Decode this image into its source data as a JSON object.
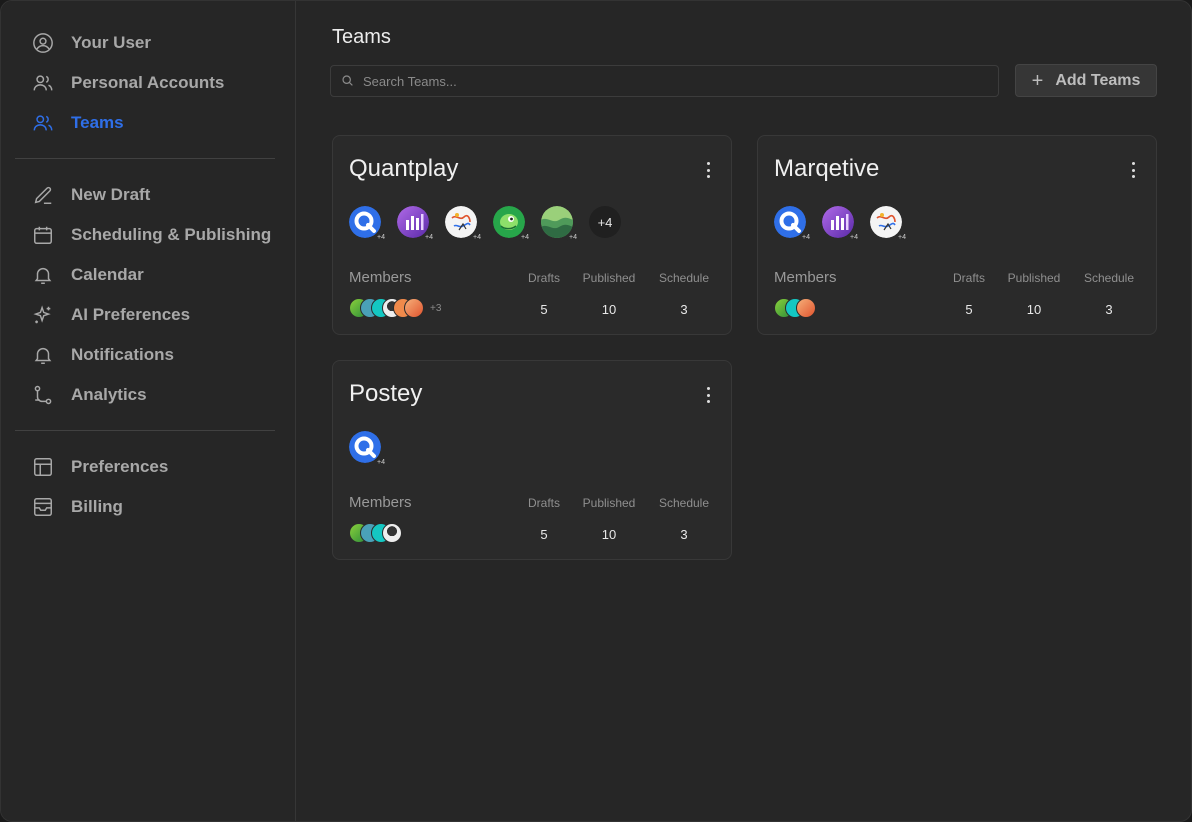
{
  "sidebar": {
    "group1": [
      {
        "label": "Your User",
        "icon": "user-circle-icon"
      },
      {
        "label": "Personal Accounts",
        "icon": "users-icon"
      },
      {
        "label": "Teams",
        "icon": "users-icon",
        "active": true
      }
    ],
    "group2": [
      {
        "label": "New Draft",
        "icon": "pencil-icon"
      },
      {
        "label": "Scheduling & Publishing",
        "icon": "calendar-icon"
      },
      {
        "label": "Calendar",
        "icon": "bell-icon"
      },
      {
        "label": "AI Preferences",
        "icon": "sparkle-icon"
      },
      {
        "label": "Notifications",
        "icon": "bell-icon"
      },
      {
        "label": "Analytics",
        "icon": "git-branch-icon"
      }
    ],
    "group3": [
      {
        "label": "Preferences",
        "icon": "layout-icon"
      },
      {
        "label": "Billing",
        "icon": "inbox-icon"
      }
    ],
    "active_color": "#2f6fe8"
  },
  "main": {
    "title": "Teams",
    "search_placeholder": "Search Teams...",
    "add_label": "Add Teams"
  },
  "stat_labels": {
    "members": "Members",
    "drafts": "Drafts",
    "published": "Published",
    "schedule": "Schedule"
  },
  "teams": [
    {
      "name": "Quantplay",
      "channels": [
        "quantplay-logo",
        "purple-bars-logo",
        "doodle-logo",
        "green-bird-logo",
        "green-wave-logo"
      ],
      "channel_badge": "+4",
      "more_channels": "+4",
      "members_more": "+3",
      "drafts": "5",
      "published": "10",
      "schedule": "3"
    },
    {
      "name": "Marqetive",
      "channels": [
        "quantplay-logo",
        "purple-bars-logo",
        "doodle-logo"
      ],
      "channel_badge": "+4",
      "more_channels": "",
      "members_more": "",
      "drafts": "5",
      "published": "10",
      "schedule": "3"
    },
    {
      "name": "Postey",
      "channels": [
        "quantplay-logo"
      ],
      "channel_badge": "+4",
      "more_channels": "",
      "members_more": "",
      "drafts": "5",
      "published": "10",
      "schedule": "3"
    }
  ]
}
